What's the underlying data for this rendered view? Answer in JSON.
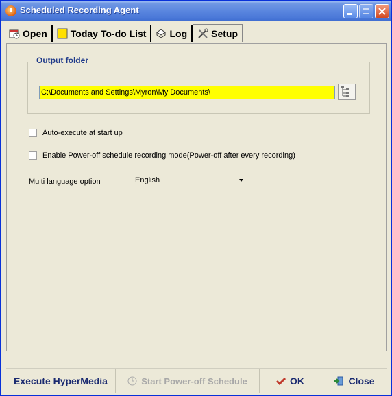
{
  "window": {
    "title": "Scheduled Recording Agent"
  },
  "tabs": [
    {
      "label": "Open",
      "icon": "open-icon"
    },
    {
      "label": "Today To-do List",
      "icon": "todo-list-icon"
    },
    {
      "label": "Log",
      "icon": "log-icon"
    },
    {
      "label": "Setup",
      "icon": "setup-tools-icon",
      "active": true
    }
  ],
  "setup": {
    "output_folder_label": "Output folder",
    "output_folder_value": "C:\\Documents and Settings\\Myron\\My Documents\\",
    "auto_execute_label": "Auto-execute at start up",
    "auto_execute_checked": false,
    "poweroff_mode_label": "Enable Power-off schedule recording mode(Power-off after every recording)",
    "poweroff_mode_checked": false,
    "language_label": "Multi language option",
    "language_value": "English"
  },
  "bottom": {
    "execute_label": "Execute HyperMedia",
    "start_poweroff_label": "Start Power-off Schedule",
    "ok_label": "OK",
    "close_label": "Close"
  },
  "colors": {
    "folder_field_bg": "#ffff00",
    "group_label": "#1f3a8a",
    "titlebar": "#4a78d8"
  }
}
